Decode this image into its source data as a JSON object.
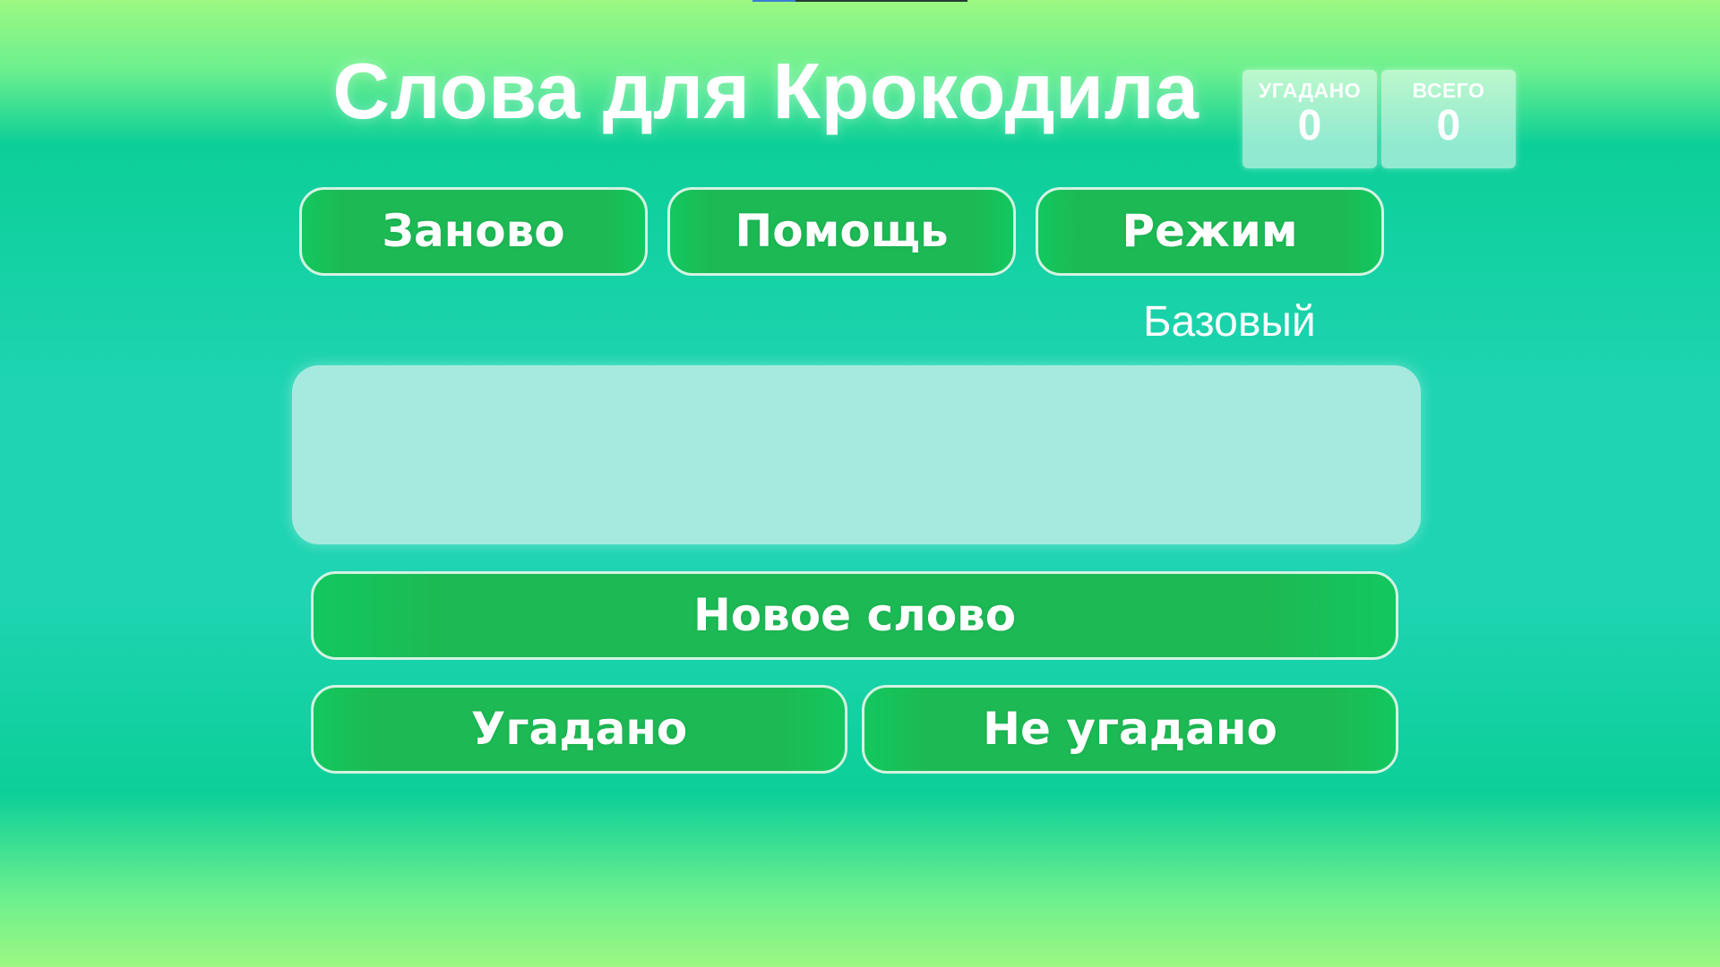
{
  "title": "Слова для Крокодила",
  "scores": {
    "guessed_label": "УГАДАНО",
    "guessed_value": "0",
    "total_label": "ВСЕГО",
    "total_value": "0"
  },
  "controls": {
    "restart_label": "Заново",
    "help_label": "Помощь",
    "mode_label": "Режим",
    "mode_value": "Базовый"
  },
  "word": {
    "current": ""
  },
  "actions": {
    "new_word_label": "Новое слово",
    "guessed_label": "Угадано",
    "not_guessed_label": "Не угадано"
  },
  "colors": {
    "button_green": "#1db954",
    "background_teal": "#1ed4b2",
    "background_light_green": "#9cf882"
  }
}
